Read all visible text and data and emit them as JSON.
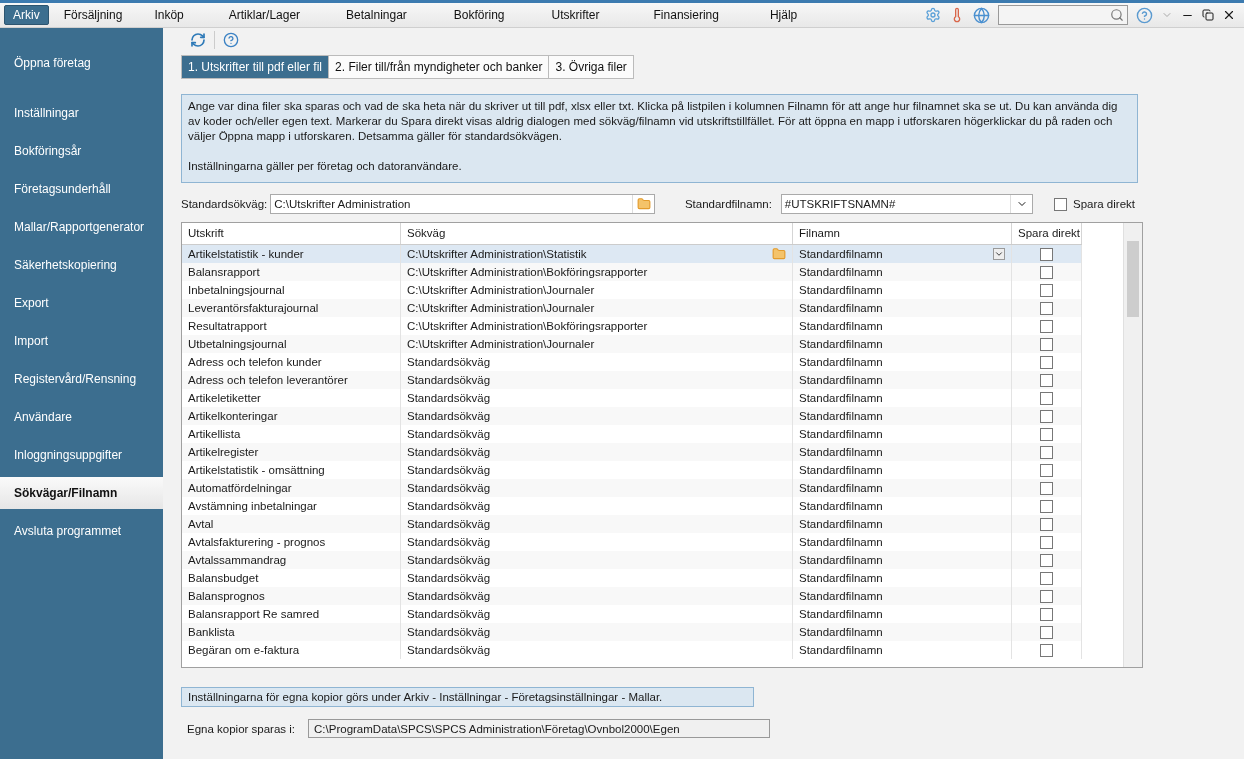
{
  "menu": [
    {
      "label": "Arkiv",
      "selected": true
    },
    {
      "label": "Försäljning",
      "selected": false
    },
    {
      "label": "Inköp",
      "selected": false
    },
    {
      "label": "Artiklar/Lager",
      "selected": false
    },
    {
      "label": "Betalningar",
      "selected": false
    },
    {
      "label": "Bokföring",
      "selected": false
    },
    {
      "label": "Utskrifter",
      "selected": false
    },
    {
      "label": "Finansiering",
      "selected": false
    },
    {
      "label": "Hjälp",
      "selected": false
    }
  ],
  "sidebar": {
    "items": [
      {
        "label": "Öppna företag",
        "selected": false
      },
      {
        "label": "Inställningar",
        "selected": false
      },
      {
        "label": "Bokföringsår",
        "selected": false
      },
      {
        "label": "Företagsunderhåll",
        "selected": false
      },
      {
        "label": "Mallar/Rapportgenerator",
        "selected": false
      },
      {
        "label": "Säkerhetskopiering",
        "selected": false
      },
      {
        "label": "Export",
        "selected": false
      },
      {
        "label": "Import",
        "selected": false
      },
      {
        "label": "Registervård/Rensning",
        "selected": false
      },
      {
        "label": "Användare",
        "selected": false
      },
      {
        "label": "Inloggningsuppgifter",
        "selected": false
      },
      {
        "label": "Sökvägar/Filnamn",
        "selected": true
      },
      {
        "label": "Avsluta programmet",
        "selected": false
      }
    ]
  },
  "tabs": [
    {
      "label": "1. Utskrifter till pdf eller fil",
      "selected": true
    },
    {
      "label": "2. Filer till/från myndigheter och banker",
      "selected": false
    },
    {
      "label": "3. Övriga filer",
      "selected": false
    }
  ],
  "info": [
    "Ange var dina filer ska sparas och vad de ska heta när du skriver ut till pdf, xlsx eller txt. Klicka på listpilen i kolumnen Filnamn för att ange hur filnamnet ska se ut. Du kan använda dig av koder och/eller egen text. Markerar du Spara direkt visas aldrig dialogen med sökväg/filnamn vid utskriftstillfället. För att öppna en mapp i utforskaren högerklickar du på raden och väljer Öppna mapp i utforskaren. Detsamma gäller för standardsökvägen.",
    "Inställningarna gäller per företag och datoranvändare."
  ],
  "defaults": {
    "path_label": "Standardsökväg:",
    "path": "C:\\Utskrifter Administration",
    "filename_label": "Standardfilnamn:",
    "filename": "#UTSKRIFTSNAMN#",
    "save_direct_label": "Spara direkt",
    "save_direct": false
  },
  "table": {
    "columns": [
      "Utskrift",
      "Sökväg",
      "Filnamn",
      "Spara direkt"
    ],
    "rows": [
      {
        "name": "Artikelstatistik - kunder",
        "path": "C:\\Utskrifter Administration\\Statistik",
        "filename": "Standardfilnamn",
        "checked": false,
        "selected": true
      },
      {
        "name": "Balansrapport",
        "path": "C:\\Utskrifter Administration\\Bokföringsrapporter",
        "filename": "Standardfilnamn",
        "checked": false,
        "selected": false
      },
      {
        "name": "Inbetalningsjournal",
        "path": "C:\\Utskrifter Administration\\Journaler",
        "filename": "Standardfilnamn",
        "checked": false,
        "selected": false
      },
      {
        "name": "Leverantörsfakturajournal",
        "path": "C:\\Utskrifter Administration\\Journaler",
        "filename": "Standardfilnamn",
        "checked": false,
        "selected": false
      },
      {
        "name": "Resultatrapport",
        "path": "C:\\Utskrifter Administration\\Bokföringsrapporter",
        "filename": "Standardfilnamn",
        "checked": false,
        "selected": false
      },
      {
        "name": "Utbetalningsjournal",
        "path": "C:\\Utskrifter Administration\\Journaler",
        "filename": "Standardfilnamn",
        "checked": false,
        "selected": false
      },
      {
        "name": "Adress och telefon kunder",
        "path": "Standardsökväg",
        "filename": "Standardfilnamn",
        "checked": false,
        "selected": false
      },
      {
        "name": "Adress och telefon leverantörer",
        "path": "Standardsökväg",
        "filename": "Standardfilnamn",
        "checked": false,
        "selected": false
      },
      {
        "name": "Artikeletiketter",
        "path": "Standardsökväg",
        "filename": "Standardfilnamn",
        "checked": false,
        "selected": false
      },
      {
        "name": "Artikelkonteringar",
        "path": "Standardsökväg",
        "filename": "Standardfilnamn",
        "checked": false,
        "selected": false
      },
      {
        "name": "Artikellista",
        "path": "Standardsökväg",
        "filename": "Standardfilnamn",
        "checked": false,
        "selected": false
      },
      {
        "name": "Artikelregister",
        "path": "Standardsökväg",
        "filename": "Standardfilnamn",
        "checked": false,
        "selected": false
      },
      {
        "name": "Artikelstatistik - omsättning",
        "path": "Standardsökväg",
        "filename": "Standardfilnamn",
        "checked": false,
        "selected": false
      },
      {
        "name": "Automatfördelningar",
        "path": "Standardsökväg",
        "filename": "Standardfilnamn",
        "checked": false,
        "selected": false
      },
      {
        "name": "Avstämning inbetalningar",
        "path": "Standardsökväg",
        "filename": "Standardfilnamn",
        "checked": false,
        "selected": false
      },
      {
        "name": "Avtal",
        "path": "Standardsökväg",
        "filename": "Standardfilnamn",
        "checked": false,
        "selected": false
      },
      {
        "name": "Avtalsfakturering - prognos",
        "path": "Standardsökväg",
        "filename": "Standardfilnamn",
        "checked": false,
        "selected": false
      },
      {
        "name": "Avtalssammandrag",
        "path": "Standardsökväg",
        "filename": "Standardfilnamn",
        "checked": false,
        "selected": false
      },
      {
        "name": "Balansbudget",
        "path": "Standardsökväg",
        "filename": "Standardfilnamn",
        "checked": false,
        "selected": false
      },
      {
        "name": "Balansprognos",
        "path": "Standardsökväg",
        "filename": "Standardfilnamn",
        "checked": false,
        "selected": false
      },
      {
        "name": "Balansrapport Re samred",
        "path": "Standardsökväg",
        "filename": "Standardfilnamn",
        "checked": false,
        "selected": false
      },
      {
        "name": "Banklista",
        "path": "Standardsökväg",
        "filename": "Standardfilnamn",
        "checked": false,
        "selected": false
      },
      {
        "name": "Begäran om e-faktura",
        "path": "Standardsökväg",
        "filename": "Standardfilnamn",
        "checked": false,
        "selected": false
      }
    ]
  },
  "note": "Inställningarna för egna kopior görs under Arkiv - Inställningar - Företagsinställningar - Mallar.",
  "copies": {
    "label": "Egna kopior sparas i:",
    "path": "C:\\ProgramData\\SPCS\\SPCS Administration\\Företag\\Ovnbol2000\\Egen"
  }
}
